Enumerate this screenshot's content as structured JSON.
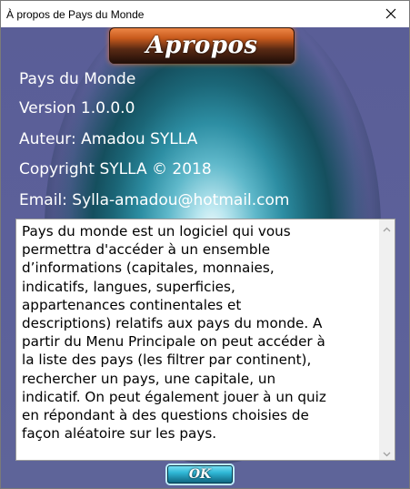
{
  "window": {
    "title": "À propos de Pays du Monde"
  },
  "banner": {
    "label": "Apropos"
  },
  "info": {
    "app_name": "Pays du Monde",
    "version": "Version 1.0.0.0",
    "author": "Auteur: Amadou SYLLA",
    "copyright": "Copyright SYLLA ©  2018",
    "email": "Email: Sylla-amadou@hotmail.com"
  },
  "description": {
    "text": "Pays du monde est un logiciel qui vous\npermettra d'accéder à un ensemble\nd’informations (capitales, monnaies,\nindicatifs, langues, superficies,\nappartenances continentales et\ndescriptions) relatifs aux pays du monde. A\npartir du Menu Principale on peut accéder à\nla liste des pays (les filtrer par continent),\nrechercher un pays, une capitale, un\nindicatif. On peut également jouer à un quiz\nen répondant à des questions choisies de\nfaçon aléatoire sur les pays."
  },
  "buttons": {
    "ok_label": "OK"
  },
  "icons": {
    "close": "close-icon",
    "scroll_up": "chevron-up-icon",
    "scroll_down": "chevron-down-icon"
  }
}
